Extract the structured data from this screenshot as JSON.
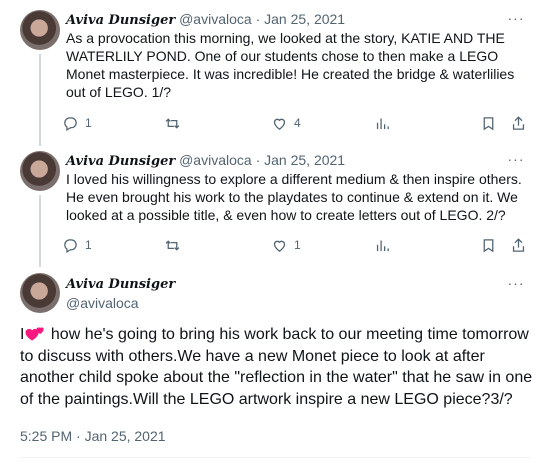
{
  "tweets": [
    {
      "name": "Aviva Dunsiger",
      "handle": "@avivaloca",
      "sep": "·",
      "date": "Jan 25, 2021",
      "text": "As a provocation this morning, we looked at the story, KATIE AND THE WATERLILY POND. One of our students chose to then make a LEGO Monet masterpiece. It was incredible! He created the bridge & waterlilies out of LEGO. 1/?",
      "reply_count": "1",
      "retweet_count": "",
      "like_count": "4"
    },
    {
      "name": "Aviva Dunsiger",
      "handle": "@avivaloca",
      "sep": "·",
      "date": "Jan 25, 2021",
      "text": "I loved his willingness to explore a different medium & then inspire others. He even brought his work to the playdates to continue & extend on it. We looked at a possible title, & even how to create letters out of LEGO. 2/?",
      "reply_count": "1",
      "retweet_count": "",
      "like_count": "1"
    }
  ],
  "main_tweet": {
    "name": "Aviva Dunsiger",
    "handle": "@avivaloca",
    "text_before_emoji": "I",
    "emoji": "two-hearts-emoji",
    "text_after_emoji": " how he's going to bring his work back to our meeting time tomorrow to discuss with others.We have a new Monet piece to look at after another child spoke about the \"reflection in the water\" that he saw in one of the paintings.Will the LEGO artwork inspire a new LEGO piece?3/?",
    "timestamp": "5:25 PM · Jan 25, 2021"
  },
  "icons": {
    "more": "more-icon",
    "reply": "reply-icon",
    "retweet": "retweet-icon",
    "like": "like-icon",
    "views": "views-icon",
    "bookmark": "bookmark-icon",
    "share": "share-icon"
  },
  "colors": {
    "text": "#0f1419",
    "muted": "#536471",
    "thread_line": "#cfd9de",
    "heart": "#f91880"
  }
}
